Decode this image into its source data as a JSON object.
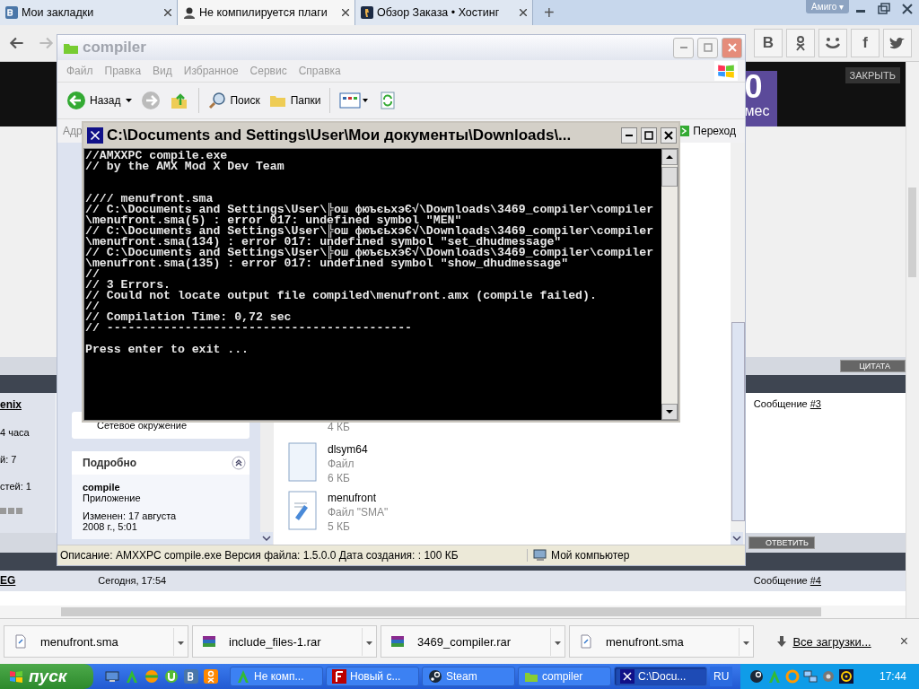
{
  "browser": {
    "tabs": [
      {
        "title": "Мои закладки",
        "selected": false,
        "kind": "vk"
      },
      {
        "title": "Не компилируется плаги",
        "selected": true,
        "kind": "avatar"
      },
      {
        "title": "Обзор Заказа • Хостинг",
        "selected": false,
        "kind": "cs"
      }
    ],
    "new_tab": "+",
    "profile": "Амиго ▾",
    "social": [
      "B",
      "f"
    ]
  },
  "page": {
    "close_button": "ЗАКРЫТЬ",
    "promo_digit": "0",
    "promo_text": "мес",
    "quote_button": "ЦИТАТА",
    "reply_button": "ОТВЕТИТЬ",
    "post": {
      "author": "enix",
      "meta": [
        "4 часа",
        "й: 7",
        "стей: 1"
      ],
      "message_label": "Сообщение",
      "message_number": "#3"
    },
    "next_post": {
      "author": "EG",
      "date": "Сегодня, 17:54",
      "message_label": "Сообщение",
      "message_number": "#4"
    }
  },
  "explorer": {
    "title": "compiler",
    "menu": [
      "Файл",
      "Правка",
      "Вид",
      "Избранное",
      "Сервис",
      "Справка"
    ],
    "back": "Назад",
    "search": "Поиск",
    "folders": "Папки",
    "address_label": "Адр",
    "go": "Переход",
    "network": "Сетевое окружение",
    "details": {
      "title": "Подробно",
      "name": "compile",
      "type": "Приложение",
      "modified": "Изменен: 17 августа 2008 г., 5:01"
    },
    "files": [
      {
        "size": "4 КБ"
      },
      {
        "kind": "blank",
        "name": "dlsym64",
        "type": "Файл",
        "size": "6 КБ"
      },
      {
        "kind": "script",
        "name": "menufront",
        "type": "Файл \"SMA\"",
        "size": "5 КБ"
      }
    ],
    "status": {
      "description": "Описание: AMXXPC compile.exe Версия файла: 1.5.0.0 Дата создания: : 100 КБ",
      "location": "Мой компьютер"
    }
  },
  "console": {
    "title": "C:\\Documents and Settings\\User\\Мои документы\\Downloads\\...",
    "blocks": [
      {
        "kind": "first",
        "lines": [
          "//AMXXPC compile.exe",
          "// by the AMX Mod X Dev Team"
        ]
      },
      {
        "kind": "wide_gap",
        "lines": [
          "//// menufront.sma",
          "// C:\\Documents and Settings\\User\\╠ош фюъєьхэЄ√\\Downloads\\3469_compiler\\compiler",
          "\\menufront.sma(5) : error 017: undefined symbol \"MEN\"",
          "// C:\\Documents and Settings\\User\\╠ош фюъєьхэЄ√\\Downloads\\3469_compiler\\compiler",
          "\\menufront.sma(134) : error 017: undefined symbol \"set_dhudmessage\"",
          "// C:\\Documents and Settings\\User\\╠ош фюъєьхэЄ√\\Downloads\\3469_compiler\\compiler",
          "\\menufront.sma(135) : error 017: undefined symbol \"show_dhudmessage\"",
          "//",
          "// 3 Errors.",
          "// Could not locate output file compiled\\menufront.amx (compile failed).",
          "//",
          "// Compilation Time: 0,72 sec",
          "// -------------------------------------------"
        ]
      },
      {
        "kind": "gap",
        "lines": [
          "Press enter to exit ..."
        ]
      }
    ]
  },
  "downloads": {
    "items": [
      {
        "name": "menufront.sma",
        "kind": "sma"
      },
      {
        "name": "include_files-1.rar",
        "kind": "rar"
      },
      {
        "name": "3469_compiler.rar",
        "kind": "rar"
      },
      {
        "name": "menufront.sma",
        "kind": "sma"
      }
    ],
    "all": "Все загрузки...",
    "close": "×"
  },
  "taskbar": {
    "start": "пуск",
    "tasks": [
      {
        "label": "Не комп...",
        "kind": "browser",
        "selected": false
      },
      {
        "label": "Новый с...",
        "kind": "ftp",
        "selected": false
      },
      {
        "label": "Steam",
        "kind": "steam",
        "selected": false
      },
      {
        "label": "compiler",
        "kind": "folder",
        "selected": false
      },
      {
        "label": "C:\\Docu...",
        "kind": "console",
        "selected": true
      }
    ],
    "lang": "RU",
    "clock": "17:44"
  }
}
